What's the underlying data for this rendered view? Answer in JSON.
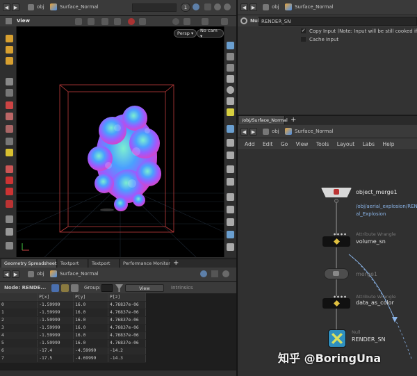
{
  "left_header": {
    "path_obj": "obj",
    "node": "Surface_Normal",
    "badge": "1"
  },
  "viewport": {
    "label": "View",
    "camera": "Persp ▾",
    "cam_menu": "No cam ▾"
  },
  "spreadsheet": {
    "tabs": [
      "Geometry Spreadsheet",
      "Textport",
      "Textport",
      "Performance Monitor"
    ],
    "path_obj": "obj",
    "node": "Surface_Normal",
    "node_label": "Node: RENDE...",
    "group_label": "Group:",
    "view_label": "View",
    "intrinsics_label": "Intrinsics",
    "columns": [
      "",
      "P[x]",
      "P[y]",
      "P[z]"
    ],
    "rows": [
      [
        "0",
        "-1.59999",
        "16.0",
        "4.76837e-06"
      ],
      [
        "1",
        "-1.59999",
        "16.0",
        "4.76837e-06"
      ],
      [
        "2",
        "-1.59999",
        "16.0",
        "4.76837e-06"
      ],
      [
        "3",
        "-1.59999",
        "16.0",
        "4.76837e-06"
      ],
      [
        "4",
        "-1.59999",
        "16.0",
        "4.76837e-06"
      ],
      [
        "5",
        "-1.59999",
        "16.0",
        "4.76837e-06"
      ],
      [
        "6",
        "-17.4",
        "-4.59999",
        "-14.2"
      ],
      [
        "7",
        "-17.5",
        "-4.69999",
        "-14.3"
      ]
    ]
  },
  "right_header": {
    "path_obj": "obj",
    "node": "Surface_Normal"
  },
  "params": {
    "node_type": "Null",
    "node_name": "RENDER_SN",
    "copy_input": "Copy Input (Note: Input will be still cooked if disable",
    "cache_input": "Cache Input"
  },
  "network": {
    "tab": "/obj/Surface_Normal",
    "path_obj": "obj",
    "node": "Surface_Normal",
    "menu": [
      "Add",
      "Edit",
      "Go",
      "View",
      "Tools",
      "Layout",
      "Labs",
      "Help"
    ],
    "nodes": {
      "object_merge": {
        "name": "object_merge1",
        "path1": "/obj/aerial_explosion/REN",
        "path2": "al_Explosion"
      },
      "volume_sn": {
        "type": "Attribute Wrangle",
        "name": "volume_sn"
      },
      "merge": {
        "name": "merge1"
      },
      "data_as_color": {
        "type": "Attribute Wrangle",
        "name": "data_as_color"
      },
      "render": {
        "type": "Null",
        "name": "RENDER_SN"
      }
    }
  },
  "watermark": "知乎 @BoringUna",
  "colors": {
    "bg": "#2b2b2b",
    "viewport": "#000000",
    "bbox": "#c03c3c",
    "accent": "#8ab4e8"
  }
}
